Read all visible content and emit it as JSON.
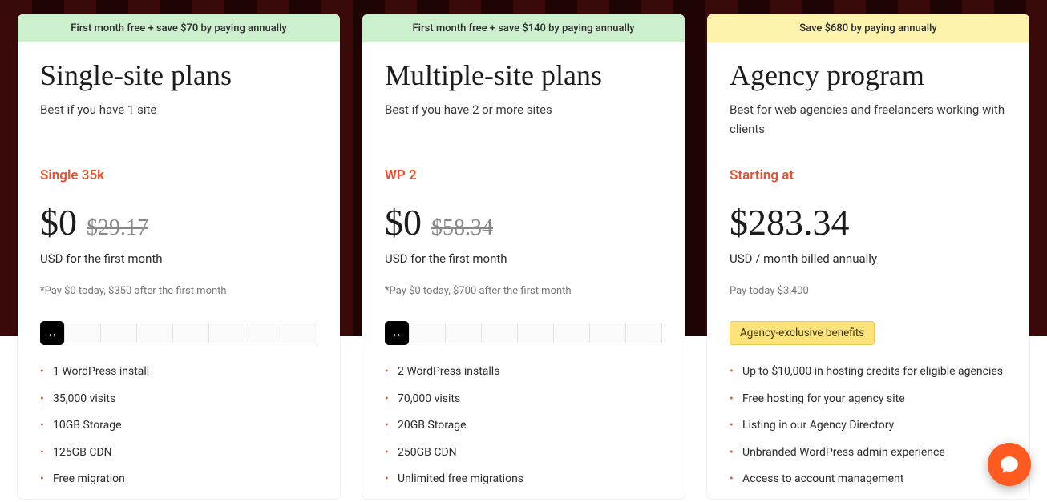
{
  "cards": [
    {
      "banner": "First month free + save $70 by paying annually",
      "bannerClass": "banner-green",
      "title": "Single-site plans",
      "subtitle": "Best if you have 1 site",
      "tier": "Single 35k",
      "price": "$0",
      "old": "$29.17",
      "priceCaption": "USD for the first month",
      "fine": "*Pay $0 today, $350 after the first month",
      "slider": true,
      "features": [
        "1 WordPress install",
        "35,000 visits",
        "10GB Storage",
        "125GB CDN",
        "Free migration"
      ]
    },
    {
      "banner": "First month free + save $140 by paying annually",
      "bannerClass": "banner-green",
      "title": "Multiple-site plans",
      "subtitle": "Best if you have 2 or more sites",
      "tier": "WP 2",
      "price": "$0",
      "old": "$58.34",
      "priceCaption": "USD for the first month",
      "fine": "*Pay $0 today, $700 after the first month",
      "slider": true,
      "features": [
        "2 WordPress installs",
        "70,000 visits",
        "20GB Storage",
        "250GB CDN",
        "Unlimited free migrations"
      ]
    },
    {
      "banner": "Save $680 by paying annually",
      "bannerClass": "banner-yellow",
      "title": "Agency program",
      "subtitle": "Best for web agencies and freelancers working with clients",
      "tier": "Starting at",
      "price": "$283.34",
      "old": "",
      "priceCaption": "USD / month billed annually",
      "fine": "Pay today $3,400",
      "slider": false,
      "badge": "Agency-exclusive benefits",
      "features": [
        "Up to $10,000 in hosting credits for eligible agencies",
        "Free hosting for your agency site",
        "Listing in our Agency Directory",
        "Unbranded WordPress admin experience",
        "Access to account management"
      ]
    }
  ]
}
